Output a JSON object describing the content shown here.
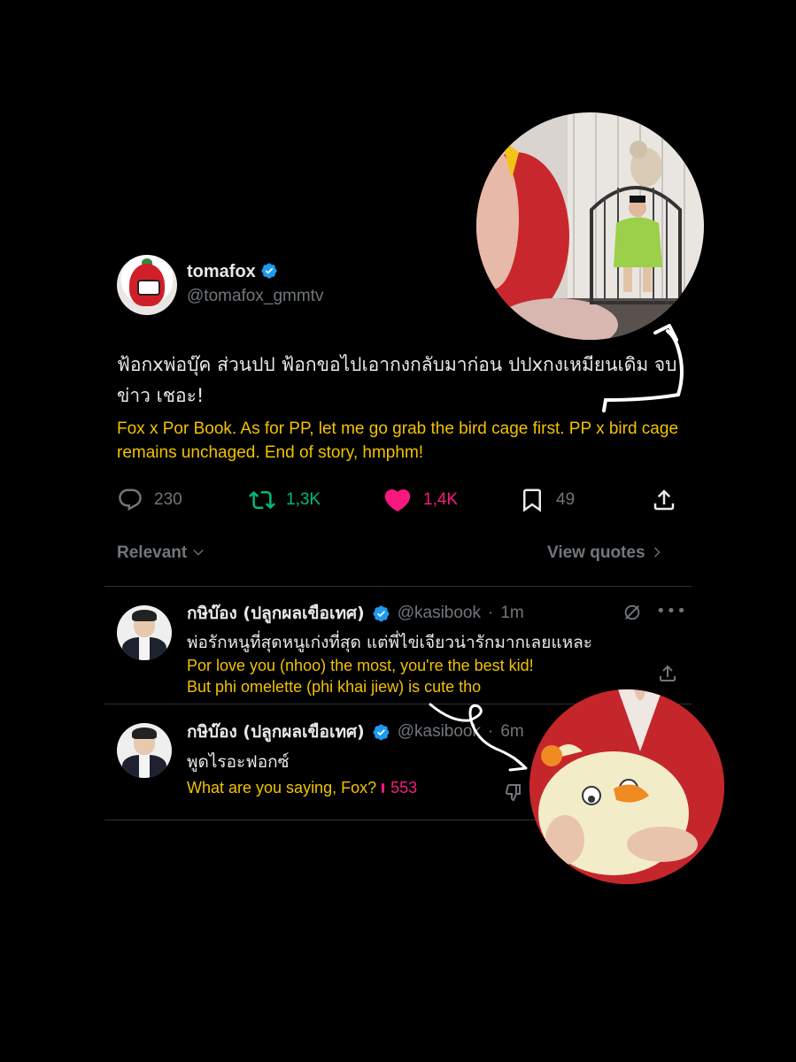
{
  "tweet": {
    "display_name": "tomafox",
    "handle": "@tomafox_gmmtv",
    "text_thai": "ฟ้อกxพ่อบุ๊ค ส่วนปป ฟ้อกขอไปเอากงกลับมาก่อน ปปxกงเหมียนเดิม จบข่าว เชอะ!",
    "translation": "Fox x Por Book. As for PP, let me go grab the bird cage first. PP x bird cage remains unchaged. End of story, hmphm!",
    "stats": {
      "replies": "230",
      "retweets": "1,3K",
      "likes": "1,4K",
      "bookmarks": "49"
    }
  },
  "sort": {
    "label": "Relevant",
    "view_quotes": "View quotes"
  },
  "replies": [
    {
      "display_name": "กษิบ๊อง (ปลูกผลเขือเทศ)",
      "handle": "@kasibook",
      "time": "1m",
      "text_thai": "พ่อรักหนูที่สุดหนูเก่งที่สุด แต่พี่ไข่เจียวน่ารักมากเลยแหละ",
      "translation_line1": "Por love you (nhoo) the most, you're the best kid!",
      "translation_line2": "But phi omelette (phi khai jiew) is cute tho"
    },
    {
      "display_name": "กษิบ๊อง (ปลูกผลเขือเทศ)",
      "handle": "@kasibook",
      "time": "6m",
      "text_thai": "พูดไรอะฟอกซ์",
      "translation": "What are you saying, Fox?",
      "likes": "553"
    }
  ],
  "colors": {
    "background": "#000000",
    "text": "#e7e9ea",
    "muted": "#71767b",
    "translation": "#f2c200",
    "retweet": "#00ba7c",
    "like": "#f91880",
    "verified": "#1d9bf0"
  }
}
